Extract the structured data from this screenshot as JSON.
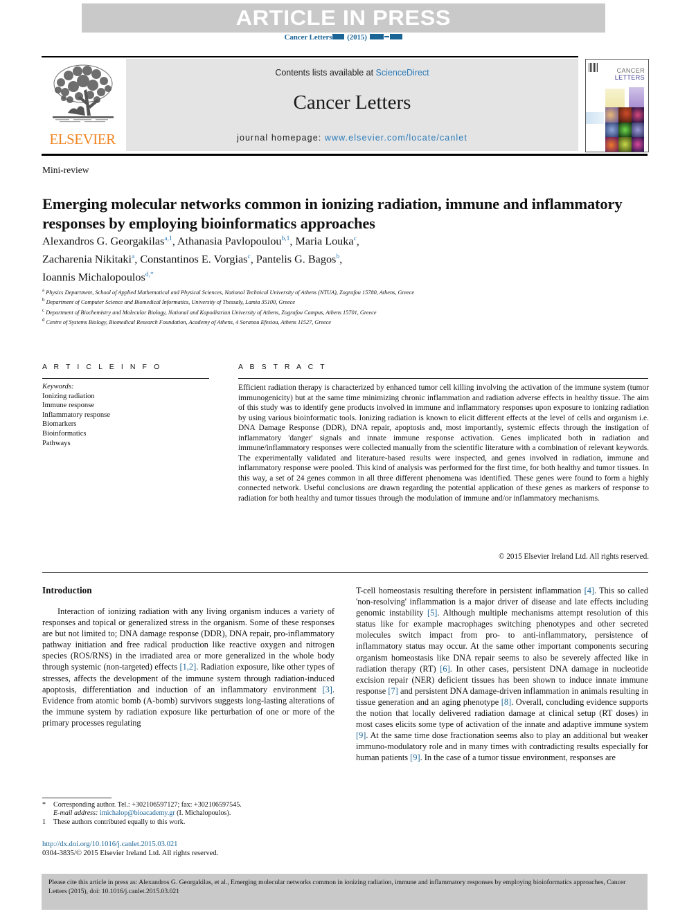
{
  "banner": {
    "text": "ARTICLE IN PRESS"
  },
  "running_head": {
    "journal": "Cancer Letters",
    "year": "(2015)"
  },
  "masthead": {
    "contents_prefix": "Contents lists available at ",
    "contents_link": "ScienceDirect",
    "journal_name": "Cancer Letters",
    "homepage_prefix": "journal homepage: ",
    "homepage_link": "www.elsevier.com/locate/canlet",
    "publisher": "ELSEVIER",
    "cover_title_line1": "CANCER",
    "cover_title_line2": "LETTERS"
  },
  "article": {
    "type": "Mini-review",
    "title": "Emerging molecular networks common in ionizing radiation, immune and inflammatory responses by employing bioinformatics approaches",
    "authors_line1": "Alexandros G. Georgakilas",
    "authors_line1_sup": "a,1",
    "authors_line1b": ", Athanasia Pavlopoulou",
    "authors_line1b_sup": "b,1",
    "authors_line1c": ", Maria Louka",
    "authors_line1c_sup": "c",
    "authors_line2": "Zacharenia Nikitaki",
    "authors_line2_sup": "a",
    "authors_line2b": ", Constantinos E. Vorgias",
    "authors_line2b_sup": "c",
    "authors_line2c": ", Pantelis G. Bagos",
    "authors_line2c_sup": "b",
    "authors_line3": "Ioannis Michalopoulos",
    "authors_line3_sup": "d,*",
    "affiliations": [
      {
        "mark": "a",
        "text": "Physics Department, School of Applied Mathematical and Physical Sciences, National Technical University of Athens (NTUA), Zografou 15780, Athens, Greece"
      },
      {
        "mark": "b",
        "text": "Department of Computer Science and Biomedical Informatics, University of Thessaly, Lamia 35100, Greece"
      },
      {
        "mark": "c",
        "text": "Department of Biochemistry and Molecular Biology, National and Kapodistrian University of Athens, Zografou Campus, Athens 15701, Greece"
      },
      {
        "mark": "d",
        "text": "Centre of Systems Biology, Biomedical Research Foundation, Academy of Athens, 4 Soranou Efesiou, Athens 11527, Greece"
      }
    ]
  },
  "article_info": {
    "heading": "A R T I C L E    I N F O",
    "keywords_label": "Keywords:",
    "keywords": [
      "Ionizing radiation",
      "Immune response",
      "Inflammatory response",
      "Biomarkers",
      "Bioinformatics",
      "Pathways"
    ]
  },
  "abstract": {
    "heading": "A B S T R A C T",
    "text": "Efficient radiation therapy is characterized by enhanced tumor cell killing involving the activation of the immune system (tumor immunogenicity) but at the same time minimizing chronic inflammation and radiation adverse effects in healthy tissue. The aim of this study was to identify gene products involved in immune and inflammatory responses upon exposure to ionizing radiation by using various bioinformatic tools. Ionizing radiation is known to elicit different effects at the level of cells and organism i.e. DNA Damage Response (DDR), DNA repair, apoptosis and, most importantly, systemic effects through the instigation of inflammatory 'danger' signals and innate immune response activation. Genes implicated both in radiation and immune/inflammatory responses were collected manually from the scientific literature with a combination of relevant keywords. The experimentally validated and literature-based results were inspected, and genes involved in radiation, immune and inflammatory response were pooled. This kind of analysis was performed for the first time, for both healthy and tumor tissues. In this way, a set of 24 genes common in all three different phenomena was identified. These genes were found to form a highly connected network. Useful conclusions are drawn regarding the potential application of these genes as markers of response to radiation for both healthy and tumor tissues through the modulation of immune and/or inflammatory mechanisms.",
    "copyright": "© 2015 Elsevier Ireland Ltd. All rights reserved."
  },
  "introduction": {
    "heading": "Introduction",
    "left_para_1": "Interaction of ionizing radiation with any living organism induces a variety of responses and topical or generalized stress in the organism. Some of these responses are but not limited to; DNA damage response (DDR), DNA repair, pro-inflammatory pathway initiation and free radical production like reactive oxygen and nitrogen species (ROS/RNS) in the irradiated area or more generalized in the whole body through systemic (non-targeted) effects ",
    "left_ref_1": "[1,2]",
    "left_para_2": ". Radiation exposure, like other types of stresses, affects the development of the immune system through radiation-induced apoptosis, differentiation and induction of an inflammatory environment ",
    "left_ref_2": "[3]",
    "left_para_3": ". Evidence from atomic bomb (A-bomb) survivors suggests long-lasting alterations of the immune system by radiation exposure like perturbation of one or more of the primary processes regulating",
    "right_para_1": "T-cell homeostasis resulting therefore in persistent inflammation ",
    "right_ref_1": "[4]",
    "right_para_2": ". This so called 'non-resolving' inflammation is a major driver of disease and late effects including genomic instability ",
    "right_ref_2": "[5]",
    "right_para_3": ". Although multiple mechanisms attempt resolution of this status like for example macrophages switching phenotypes and other secreted molecules switch impact from pro- to anti-inflammatory, persistence of inflammatory status may occur. At the same other important components securing organism homeostasis like DNA repair seems to also be severely affected like in radiation therapy (RT) ",
    "right_ref_3": "[6]",
    "right_para_4": ". In other cases, persistent DNA damage in nucleotide excision repair (NER) deficient tissues has been shown to induce innate immune response ",
    "right_ref_4": "[7]",
    "right_para_5": " and persistent DNA damage-driven inflammation in animals resulting in tissue generation and an aging phenotype ",
    "right_ref_5": "[8]",
    "right_para_6": ". Overall, concluding evidence supports the notion that locally delivered radiation damage at clinical setup (RT doses) in most cases elicits some type of activation of the innate and adaptive immune system ",
    "right_ref_6": "[9]",
    "right_para_7": ". At the same time dose fractionation seems also to play an additional but weaker immuno-modulatory role and in many times with contradicting results especially for human patients ",
    "right_ref_7": "[9]",
    "right_para_8": ". In the case of a tumor tissue environment, responses are"
  },
  "footnotes": {
    "corresponding_mark": "*",
    "corresponding_text": "Corresponding author. Tel.: +302106597127; fax: +302106597545.",
    "email_label": "E-mail address:",
    "email": "imichalop@bioacademy.gr",
    "email_suffix": "(I. Michalopoulos).",
    "equal_mark": "1",
    "equal_text": "These authors contributed equally to this work.",
    "doi_link": "http://dx.doi.org/10.1016/j.canlet.2015.03.021",
    "issn_line": "0304-3835/© 2015 Elsevier Ireland Ltd. All rights reserved."
  },
  "cite_box": {
    "text": "Please cite this article in press as: Alexandros G. Georgakilas, et al., Emerging molecular networks common in ionizing radiation, immune and inflammatory responses by employing bioinformatics approaches, Cancer Letters (2015), doi: 10.1016/j.canlet.2015.03.021"
  },
  "colors": {
    "link_blue": "#2b7bb9",
    "ref_blue": "#1a6496",
    "elsevier_orange": "#F08522",
    "banner_grey": "#c9c9c9",
    "masthead_grey": "#e4e4e4"
  }
}
